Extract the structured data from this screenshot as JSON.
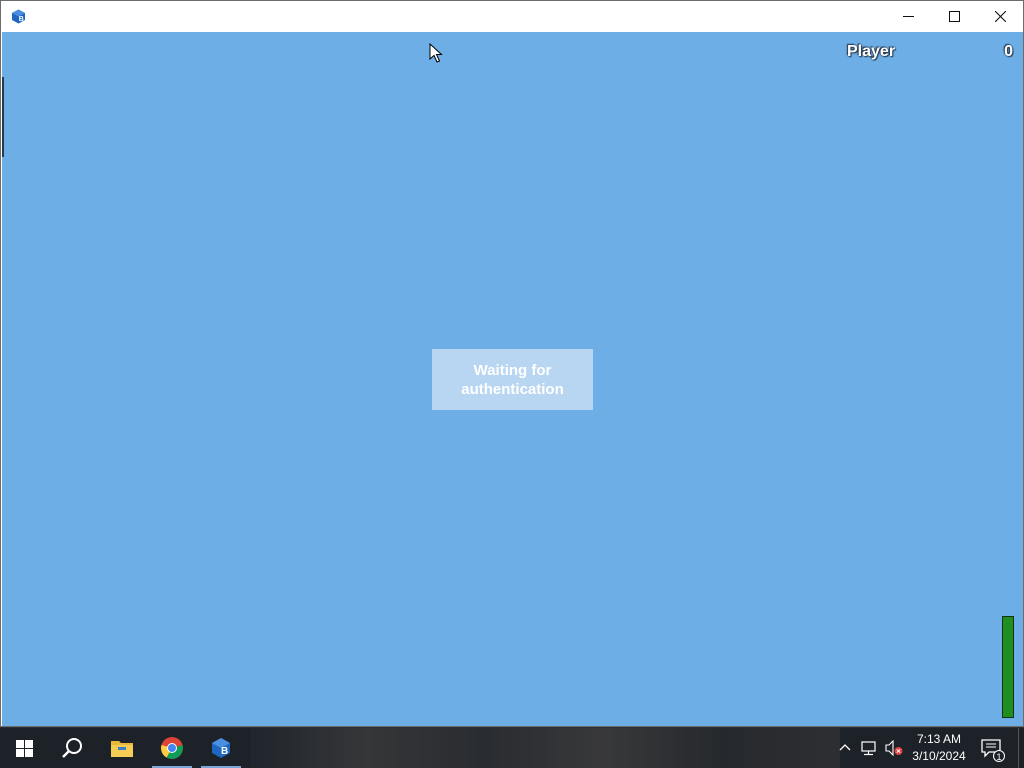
{
  "window": {
    "title": "",
    "controls": {
      "minimize": "minimize-icon",
      "maximize": "maximize-icon",
      "close": "close-icon"
    }
  },
  "game": {
    "background_color": "#6daee6",
    "hud": {
      "player_label": "Player",
      "score": "0"
    },
    "auth_message": "Waiting for authentication",
    "health_level_fraction": 1.0,
    "health_color": "#1f8f1f"
  },
  "taskbar": {
    "items": [
      {
        "name": "start",
        "icon": "windows-logo-icon"
      },
      {
        "name": "search",
        "icon": "search-icon"
      },
      {
        "name": "file-explorer",
        "icon": "folder-icon"
      },
      {
        "name": "chrome",
        "icon": "chrome-icon"
      },
      {
        "name": "game-app",
        "icon": "app-cube-icon"
      }
    ],
    "tray": {
      "chevron": "chevron-up-icon",
      "network": "network-icon",
      "volume": "volume-muted-icon"
    },
    "clock": {
      "time": "7:13 AM",
      "date": "3/10/2024"
    },
    "notification_count": "1"
  }
}
